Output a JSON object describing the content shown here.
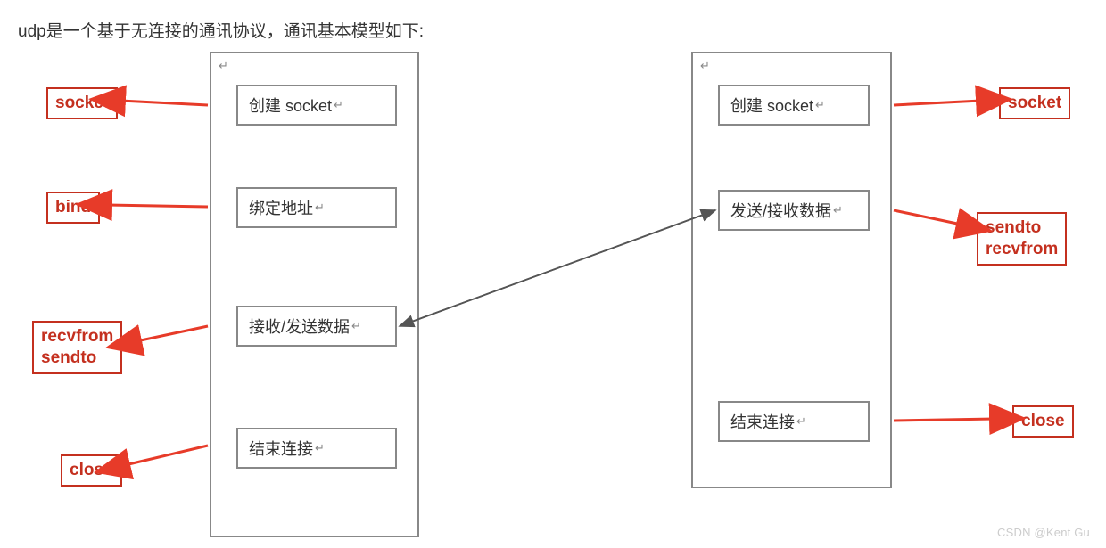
{
  "intro_text": "udp是一个基于无连接的通讯协议，通讯基本模型如下:",
  "left": {
    "steps": [
      {
        "text": "创建 socket"
      },
      {
        "text": "绑定地址"
      },
      {
        "text": "接收/发送数据"
      },
      {
        "text": "结束连接"
      }
    ],
    "labels": [
      "socket",
      "bind",
      "recvfrom\nsendto",
      "close"
    ]
  },
  "right": {
    "steps": [
      {
        "text": "创建 socket"
      },
      {
        "text": "发送/接收数据"
      },
      {
        "text": "结束连接"
      }
    ],
    "labels": [
      "socket",
      "sendto\nrecvfrom",
      "close"
    ]
  },
  "return_char": "↵",
  "watermark": "CSDN @Kent Gu"
}
